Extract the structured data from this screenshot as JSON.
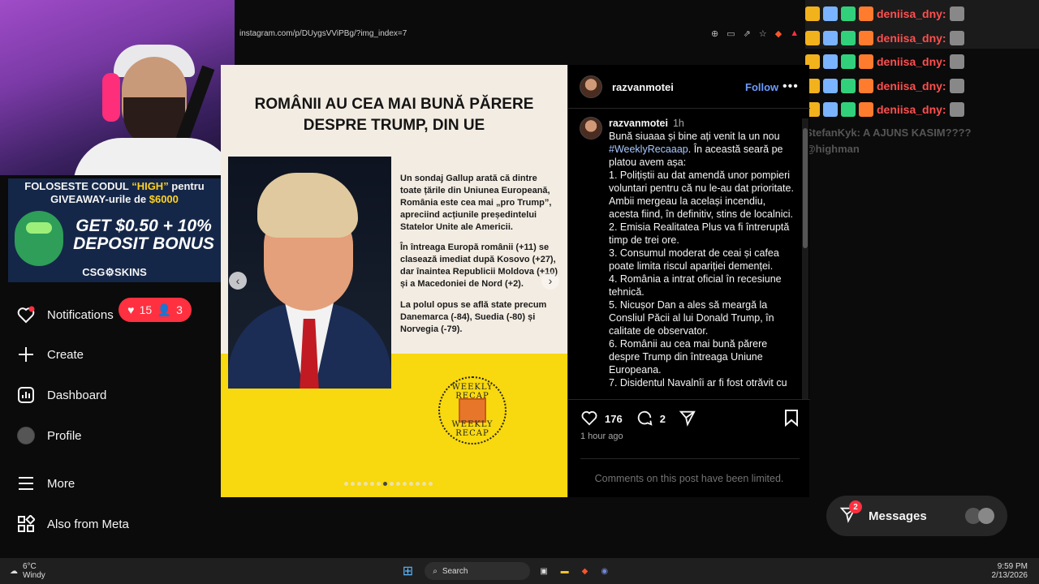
{
  "browser": {
    "url": "instagram.com/p/DUygsVViPBg/?img_index=7"
  },
  "promo": {
    "line1_white_a": "FOLOSESTE CODUL ",
    "line1_yellow": "“HIGH”",
    "line1_white_b": " pentru",
    "line2_white": "GIVEAWAY-urile de ",
    "line2_yellow": "$6000",
    "big": "GET $0.50 + 10% DEPOSIT BONUS",
    "logo": "CSG⚙SKINS"
  },
  "sidebar": {
    "notifications": "Notifications",
    "notif_hearts": "15",
    "notif_people": "3",
    "create": "Create",
    "dashboard": "Dashboard",
    "profile": "Profile",
    "more": "More",
    "also_meta": "Also from Meta"
  },
  "slide": {
    "title": "ROMÂNII AU CEA MAI BUNĂ PĂRERE DESPRE TRUMP, DIN UE",
    "para1": "Un sondaj Gallup arată că dintre toate țările din Uniunea Europeană, România este cea mai „pro Trump”, apreciind acțiunile președintelui Statelor Unite ale Americii.",
    "para2": "În întreaga Europă românii (+11) se clasează imediat după Kosovo (+27), dar înaintea Republicii Moldova (+10) și a Macedoniei de Nord (+2).",
    "para3": "La polul opus se află state precum Danemarca (-84), Suedia (-80) și Norvegia (-79).",
    "badge_top": "WEEKLY RECAP",
    "badge_bottom": "WEEKLY RECAP",
    "dots_total": 14,
    "dots_active": 7
  },
  "post": {
    "username": "razvanmotei",
    "follow": "Follow",
    "caption_user": "razvanmotei",
    "caption_time": "1h",
    "caption_lines": [
      "Bună siuaaa și bine ați venit la un nou",
      "#WeeklyRecaaap",
      ". În această seară pe platou avem așa:",
      "1. Polițiștii au dat amendă unor pompieri voluntari pentru că nu le-au dat prioritate. Ambii mergeau la același incendiu, acesta fiind, în definitiv, stins de localnici.",
      "2. Emisia Realitatea Plus va fi întreruptă timp de trei ore.",
      "3. Consumul moderat de ceai și cafea poate limita riscul apariției demenței.",
      "4. România a intrat oficial în recesiune tehnică.",
      "5. Nicușor Dan a ales să meargă la Consliul Păcii al lui Donald Trump, în calitate de observator.",
      "6. Românii au cea mai bună părere despre Trump din întreaga Uniune Europeana.",
      "7. Disidentul Navalnîi ar fi fost otrăvit cu"
    ],
    "likes": "176",
    "comments": "2",
    "posted": "1 hour ago",
    "limited": "Comments on this post have been limited."
  },
  "messages": {
    "label": "Messages",
    "badge": "2"
  },
  "chat": {
    "name": "deniisa_dny:",
    "line1": "StefanKyk: A AJUNS KASIM????",
    "line2": "@highman"
  },
  "taskbar": {
    "temp": "6°C",
    "weather": "Windy",
    "search": "Search",
    "time": "9:59 PM",
    "date": "2/13/2026"
  },
  "colors": {
    "notif": "#ff3040",
    "link": "#a8c8ff",
    "follow": "#6b9bff",
    "slide_yellow": "#f8d80e"
  }
}
